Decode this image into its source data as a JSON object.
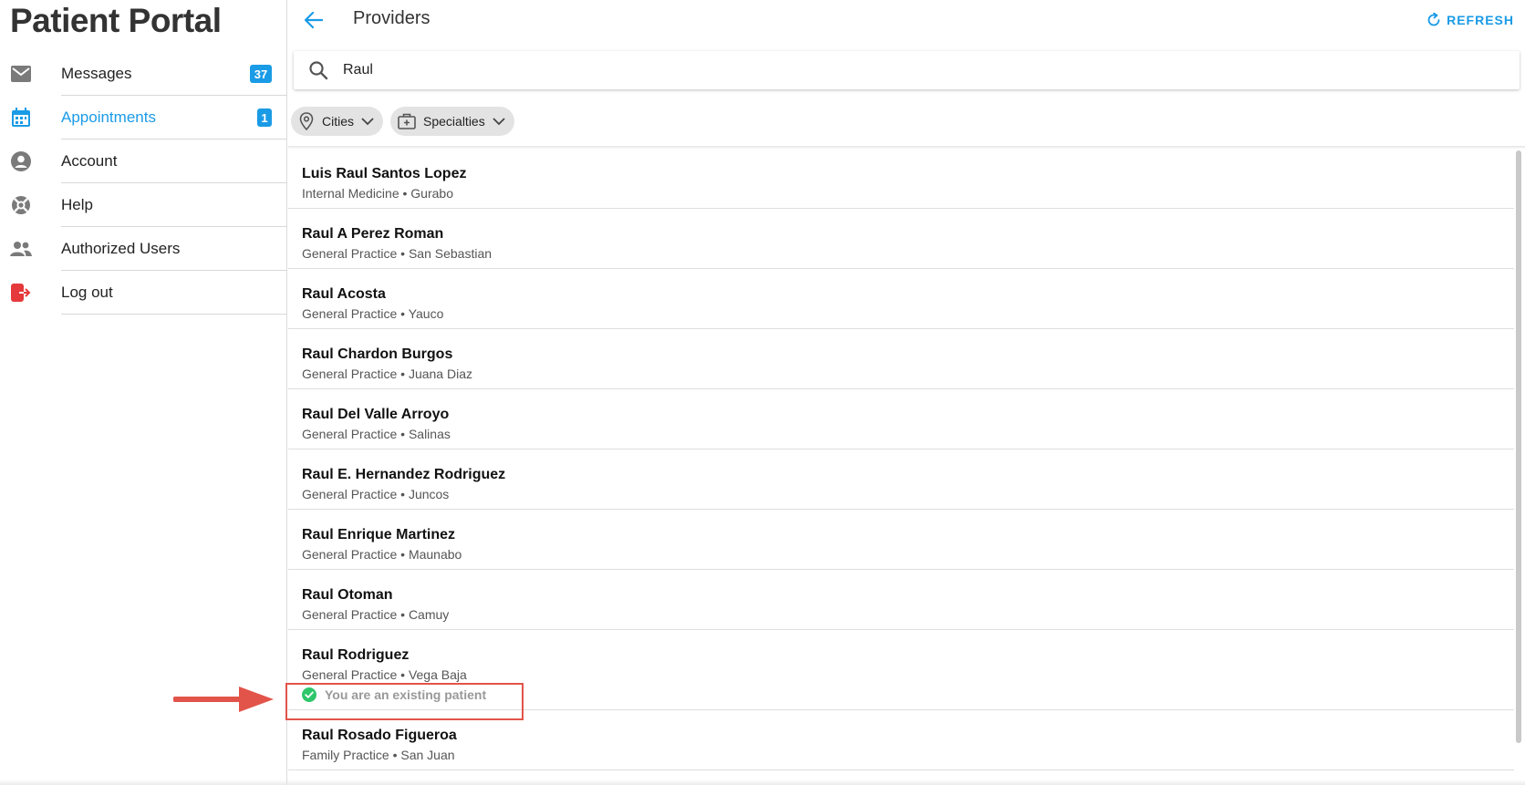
{
  "app": {
    "title": "Patient Portal"
  },
  "sidebar": {
    "items": [
      {
        "label": "Messages",
        "icon": "mail-icon",
        "badge": "37",
        "active": false
      },
      {
        "label": "Appointments",
        "icon": "calendar-icon",
        "badge": "1",
        "active": true
      },
      {
        "label": "Account",
        "icon": "account-icon",
        "badge": null,
        "active": false
      },
      {
        "label": "Help",
        "icon": "lifebuoy-icon",
        "badge": null,
        "active": false
      },
      {
        "label": "Authorized Users",
        "icon": "users-icon",
        "badge": null,
        "active": false
      },
      {
        "label": "Log out",
        "icon": "logout-icon",
        "badge": null,
        "active": false
      }
    ]
  },
  "header": {
    "title": "Providers",
    "refresh_label": "REFRESH"
  },
  "search": {
    "value": "Raul"
  },
  "filters": {
    "cities_label": "Cities",
    "specialties_label": "Specialties"
  },
  "providers": [
    {
      "name": "Luis Raul Santos Lopez",
      "detail": "Internal Medicine • Gurabo"
    },
    {
      "name": "Raul A Perez Roman",
      "detail": "General Practice • San Sebastian"
    },
    {
      "name": "Raul Acosta",
      "detail": "General Practice • Yauco"
    },
    {
      "name": "Raul Chardon Burgos",
      "detail": "General Practice • Juana Diaz"
    },
    {
      "name": "Raul Del Valle Arroyo",
      "detail": "General Practice • Salinas"
    },
    {
      "name": "Raul E. Hernandez Rodriguez",
      "detail": "General Practice • Juncos"
    },
    {
      "name": "Raul Enrique Martinez",
      "detail": "General Practice • Maunabo"
    },
    {
      "name": "Raul Otoman",
      "detail": "General Practice • Camuy"
    },
    {
      "name": "Raul Rodriguez",
      "detail": "General Practice • Vega Baja",
      "status": "You are an existing patient"
    },
    {
      "name": "Raul Rosado Figueroa",
      "detail": "Family Practice • San Juan"
    }
  ],
  "colors": {
    "accent": "#1a9be6",
    "logout": "#e5393b",
    "success": "#2ec66b",
    "annotation": "#e2544a"
  }
}
